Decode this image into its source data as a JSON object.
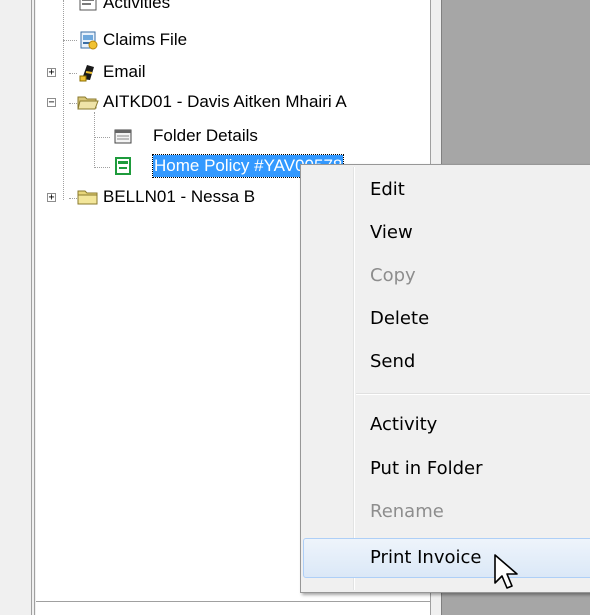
{
  "tree": {
    "items": [
      {
        "label": "Activities",
        "icon": "activities-icon"
      },
      {
        "label": "Claims File",
        "icon": "claims-file-icon"
      },
      {
        "label": "Email",
        "icon": "email-icon",
        "expander": "+"
      },
      {
        "label": "AITKD01 - Davis Aitken Mhairi A",
        "icon": "open-folder-icon",
        "expander": "−"
      },
      {
        "label": "Folder Details",
        "icon": "folder-details-icon"
      },
      {
        "label": "Home Policy #YAV00578",
        "icon": "policy-document-icon",
        "selected": true
      },
      {
        "label": "BELLN01 - Nessa B",
        "icon": "folder-icon",
        "expander": "+"
      }
    ]
  },
  "context_menu": {
    "items": [
      {
        "label": "Edit",
        "enabled": true
      },
      {
        "label": "View",
        "enabled": true
      },
      {
        "label": "Copy",
        "enabled": false
      },
      {
        "label": "Delete",
        "enabled": true
      },
      {
        "label": "Send",
        "enabled": true
      },
      {
        "label": "Activity",
        "enabled": true
      },
      {
        "label": "Put in Folder",
        "enabled": true
      },
      {
        "label": "Rename",
        "enabled": false
      },
      {
        "label": "Print Invoice",
        "enabled": true,
        "hovered": true
      }
    ]
  },
  "colors": {
    "selection": "#3399ff",
    "right_panel": "#a6a6a6",
    "menu_background": "#f0f0f0",
    "disabled_text": "#8d8d8d"
  }
}
